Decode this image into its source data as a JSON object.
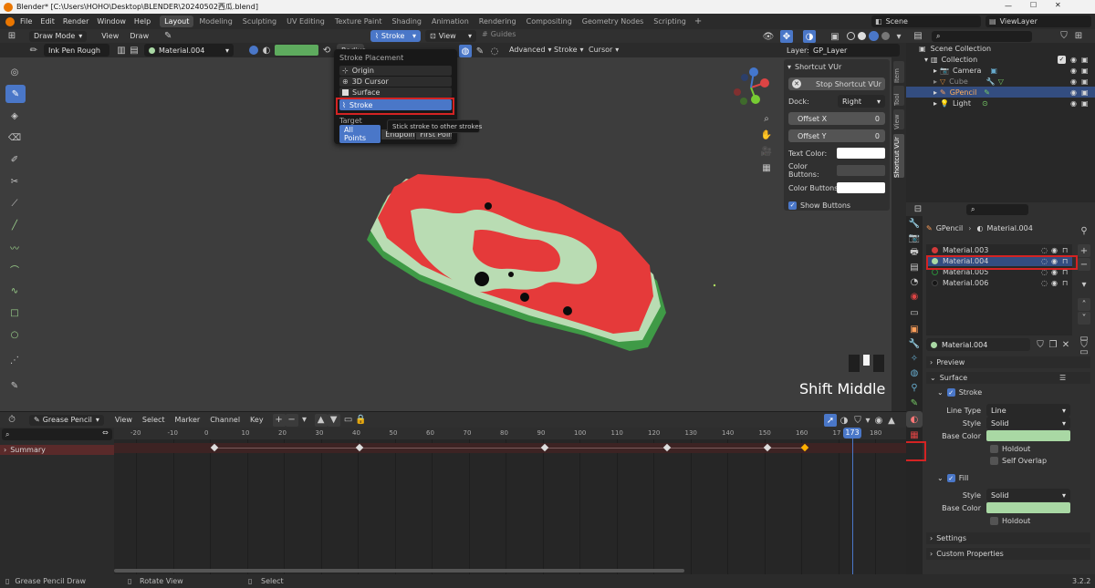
{
  "window": {
    "title": "Blender* [C:\\Users\\HOHO\\Desktop\\BLENDER\\20240502西瓜.blend]"
  },
  "menu": [
    "File",
    "Edit",
    "Render",
    "Window",
    "Help"
  ],
  "workspaces": [
    "Layout",
    "Modeling",
    "Sculpting",
    "UV Editing",
    "Texture Paint",
    "Shading",
    "Animation",
    "Rendering",
    "Compositing",
    "Geometry Nodes",
    "Scripting"
  ],
  "scene": "Scene",
  "view_layer": "ViewLayer",
  "header": {
    "mode": "Draw Mode",
    "view": "View",
    "draw": "Draw",
    "placement": "Stroke",
    "view2": "View",
    "guides": "Guides",
    "layer_label": "Layer:",
    "layer": "GP_Layer"
  },
  "toolbar": {
    "brush": "Ink Pen Rough",
    "material": "Material.004",
    "radius": "Radius",
    "advanced": "Advanced",
    "stroke": "Stroke",
    "cursor": "Cursor"
  },
  "dropdown": {
    "title": "Stroke Placement",
    "items": [
      "Origin",
      "3D Cursor",
      "Surface",
      "Stroke"
    ],
    "target_label": "Target",
    "target_options": [
      "All Points",
      "Endpoints",
      "First Point"
    ],
    "tooltip": "Stick stroke to other strokes"
  },
  "side_tabs": [
    "Item",
    "Tool",
    "View",
    "Shortcut VUr"
  ],
  "sidepanel": {
    "title": "Shortcut VUr",
    "stop": "Stop Shortcut VUr",
    "dock_label": "Dock:",
    "dock": "Right",
    "offx_label": "Offset X",
    "offx": "0",
    "offy_label": "Offset Y",
    "offy": "0",
    "text_color_label": "Text Color:",
    "color_buttons_label": "Color Buttons:",
    "color_buttons_a_label": "Color Buttons a...",
    "show_buttons": "Show Buttons"
  },
  "overlay_text": "Shift Middle",
  "outliner": {
    "root": "Scene Collection",
    "items": [
      {
        "name": "Collection",
        "color": "#e0e0e0"
      },
      {
        "name": "Camera",
        "color": "#e0e0e0"
      },
      {
        "name": "Cube",
        "color": "#8a8a8a"
      },
      {
        "name": "GPencil",
        "color": "#ffae5c"
      },
      {
        "name": "Light",
        "color": "#e0e0e0"
      }
    ]
  },
  "properties": {
    "breadcrumb": [
      "GPencil",
      "Material.004"
    ],
    "materials": [
      {
        "name": "Material.003",
        "color": "#d23a3a"
      },
      {
        "name": "Material.004",
        "color": "#a9d8a4"
      },
      {
        "name": "Material.005",
        "color": "#2b8a3a"
      },
      {
        "name": "Material.006",
        "color": "#161616"
      }
    ],
    "material_name": "Material.004",
    "preview": "Preview",
    "surface": "Surface",
    "stroke": "Stroke",
    "line_type_label": "Line Type",
    "line_type": "Line",
    "style_label": "Style",
    "style": "Solid",
    "base_color_label": "Base Color",
    "holdout": "Holdout",
    "self_overlap": "Self Overlap",
    "fill": "Fill",
    "fill_style": "Solid",
    "fill_holdout": "Holdout",
    "settings": "Settings",
    "custom_props": "Custom Properties",
    "accent": "#a9d8a4"
  },
  "dopesheet": {
    "mode": "Grease Pencil",
    "menus": [
      "View",
      "Select",
      "Marker",
      "Channel",
      "Key"
    ],
    "summary": "Summary",
    "ticks": [
      "-20",
      "-10",
      "0",
      "10",
      "20",
      "30",
      "40",
      "50",
      "60",
      "70",
      "80",
      "90",
      "100",
      "110",
      "120",
      "130",
      "140",
      "150",
      "160",
      "17",
      "180"
    ],
    "current_frame": "173"
  },
  "status": {
    "left": "Grease Pencil Draw",
    "middle": "Rotate View",
    "right": "Select",
    "version": "3.2.2"
  }
}
